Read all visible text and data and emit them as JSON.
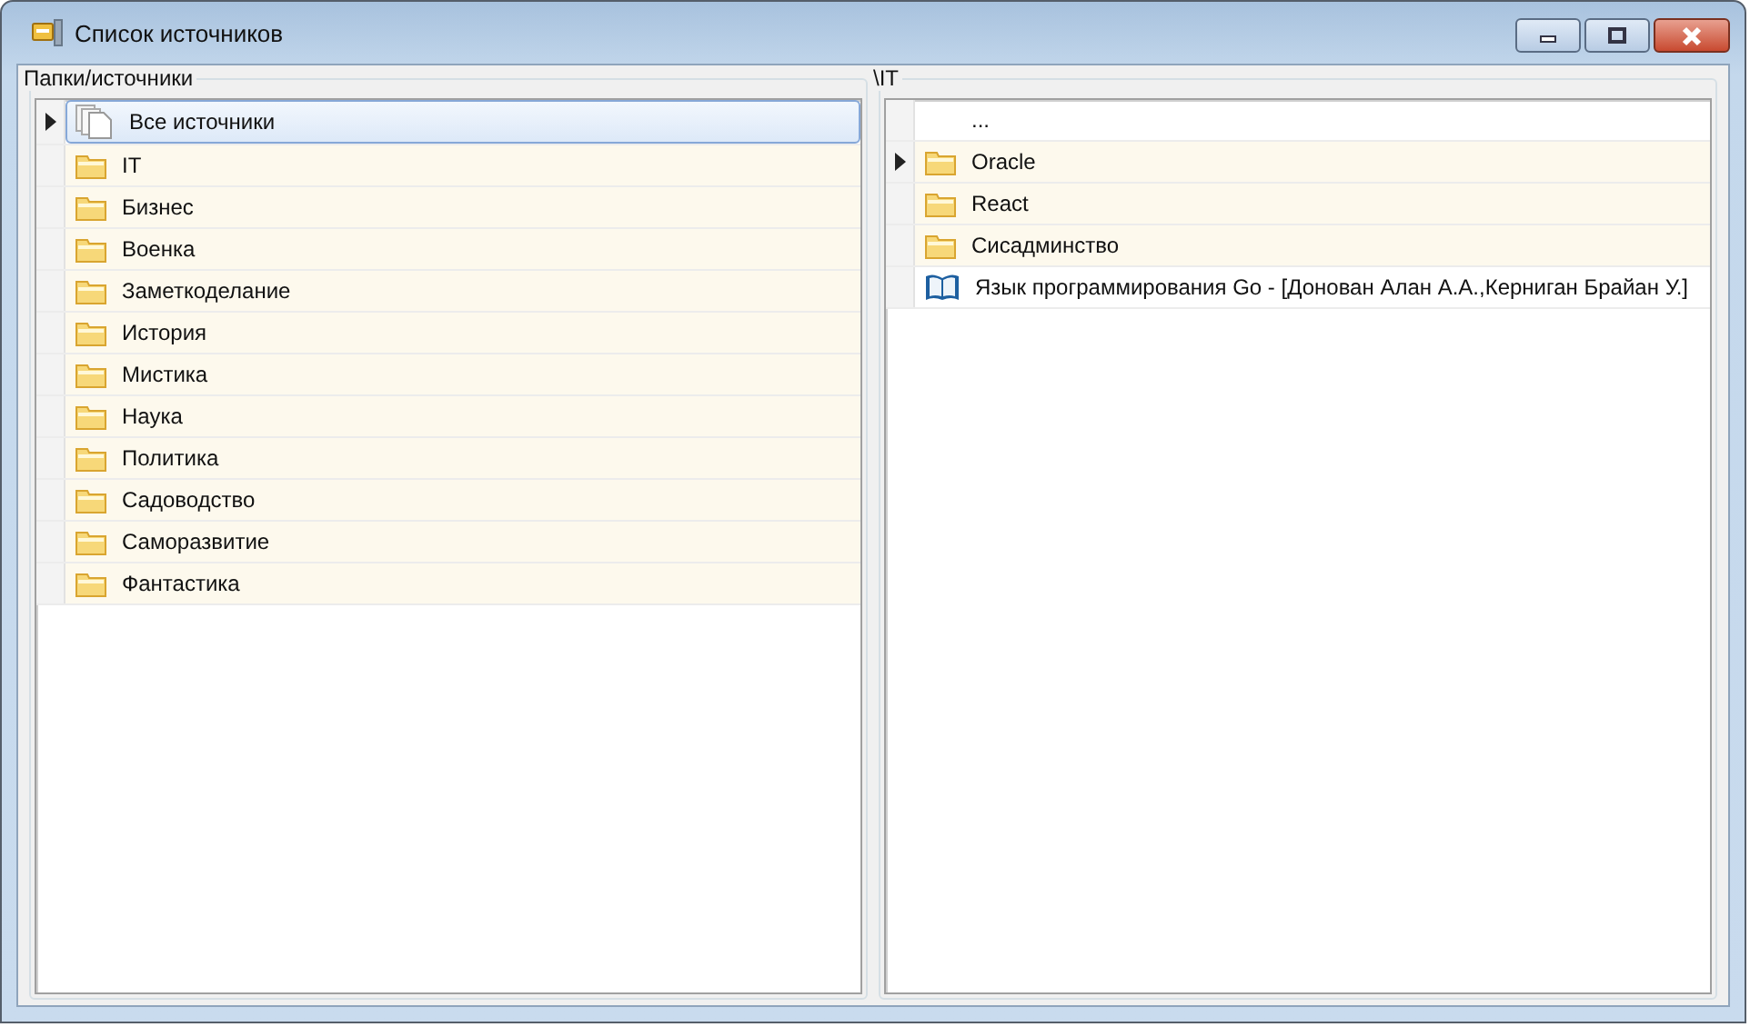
{
  "window": {
    "title": "Список источников"
  },
  "left_panel": {
    "title": "Папки/источники",
    "rows": [
      {
        "kind": "all",
        "label": "Все источники",
        "current": true,
        "selected": true
      },
      {
        "kind": "folder",
        "label": "IT",
        "current": false,
        "selected": false
      },
      {
        "kind": "folder",
        "label": "Бизнес",
        "current": false,
        "selected": false
      },
      {
        "kind": "folder",
        "label": "Военка",
        "current": false,
        "selected": false
      },
      {
        "kind": "folder",
        "label": "Заметкоделание",
        "current": false,
        "selected": false
      },
      {
        "kind": "folder",
        "label": "История",
        "current": false,
        "selected": false
      },
      {
        "kind": "folder",
        "label": "Мистика",
        "current": false,
        "selected": false
      },
      {
        "kind": "folder",
        "label": "Наука",
        "current": false,
        "selected": false
      },
      {
        "kind": "folder",
        "label": "Политика",
        "current": false,
        "selected": false
      },
      {
        "kind": "folder",
        "label": "Садоводство",
        "current": false,
        "selected": false
      },
      {
        "kind": "folder",
        "label": "Саморазвитие",
        "current": false,
        "selected": false
      },
      {
        "kind": "folder",
        "label": "Фантастика",
        "current": false,
        "selected": false
      }
    ]
  },
  "right_panel": {
    "title": "\\IT",
    "rows": [
      {
        "kind": "up",
        "label": "...",
        "current": false,
        "selected": false
      },
      {
        "kind": "folder",
        "label": "Oracle",
        "current": true,
        "selected": false
      },
      {
        "kind": "folder",
        "label": "React",
        "current": false,
        "selected": false
      },
      {
        "kind": "folder",
        "label": "Сисадминство",
        "current": false,
        "selected": false
      },
      {
        "kind": "book",
        "label": "Язык программирования Go - [Донован Алан А.А.,Керниган Брайан У.]",
        "current": false,
        "selected": false
      }
    ]
  }
}
